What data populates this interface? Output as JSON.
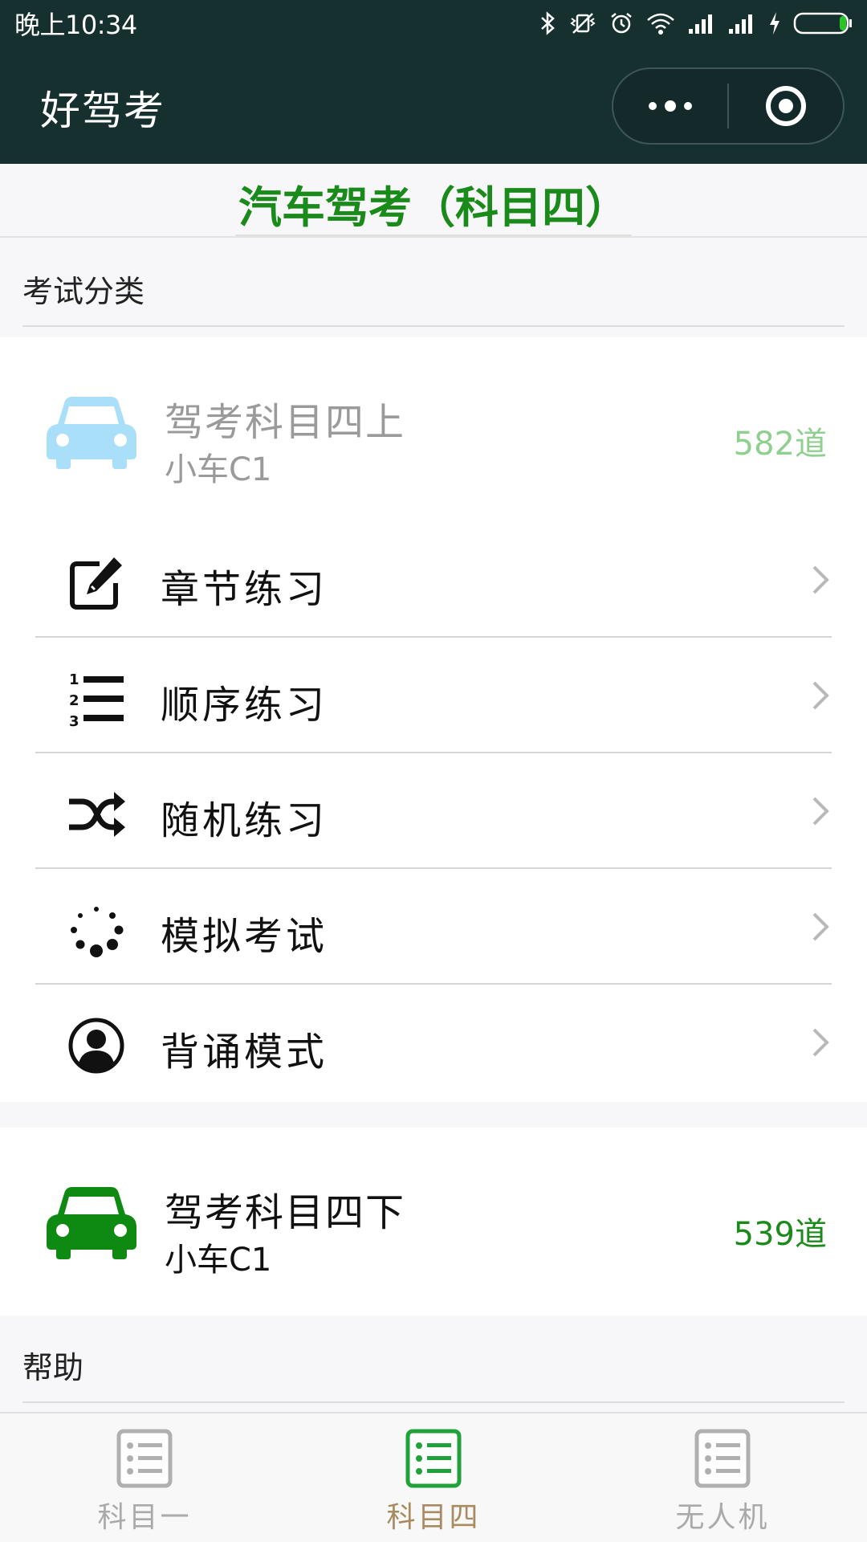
{
  "status_bar": {
    "time": "晚上10:34"
  },
  "nav": {
    "title": "好驾考"
  },
  "page": {
    "title": "汽车驾考（科目四）"
  },
  "sections": {
    "exam_category": "考试分类",
    "help": "帮助"
  },
  "cards": [
    {
      "name": "驾考科目四上",
      "subtitle": "小车C1",
      "count": "582道",
      "icon": "car-icon",
      "color": "#a9dff8"
    },
    {
      "name": "驾考科目四下",
      "subtitle": "小车C1",
      "count": "539道",
      "icon": "car-icon",
      "color": "#0e8a12"
    }
  ],
  "menu": [
    {
      "label": "章节练习",
      "icon": "edit-icon"
    },
    {
      "label": "顺序练习",
      "icon": "ordered-list-icon"
    },
    {
      "label": "随机练习",
      "icon": "shuffle-icon"
    },
    {
      "label": "模拟考试",
      "icon": "spinner-icon"
    },
    {
      "label": "背诵模式",
      "icon": "user-circle-icon"
    }
  ],
  "tabs": [
    {
      "label": "科目一",
      "selected": false
    },
    {
      "label": "科目四",
      "selected": true
    },
    {
      "label": "无人机",
      "selected": false
    }
  ],
  "colors": {
    "header_bg": "#16302f",
    "accent_green": "#1a8a1a",
    "tab_selected": "#a88b60"
  }
}
